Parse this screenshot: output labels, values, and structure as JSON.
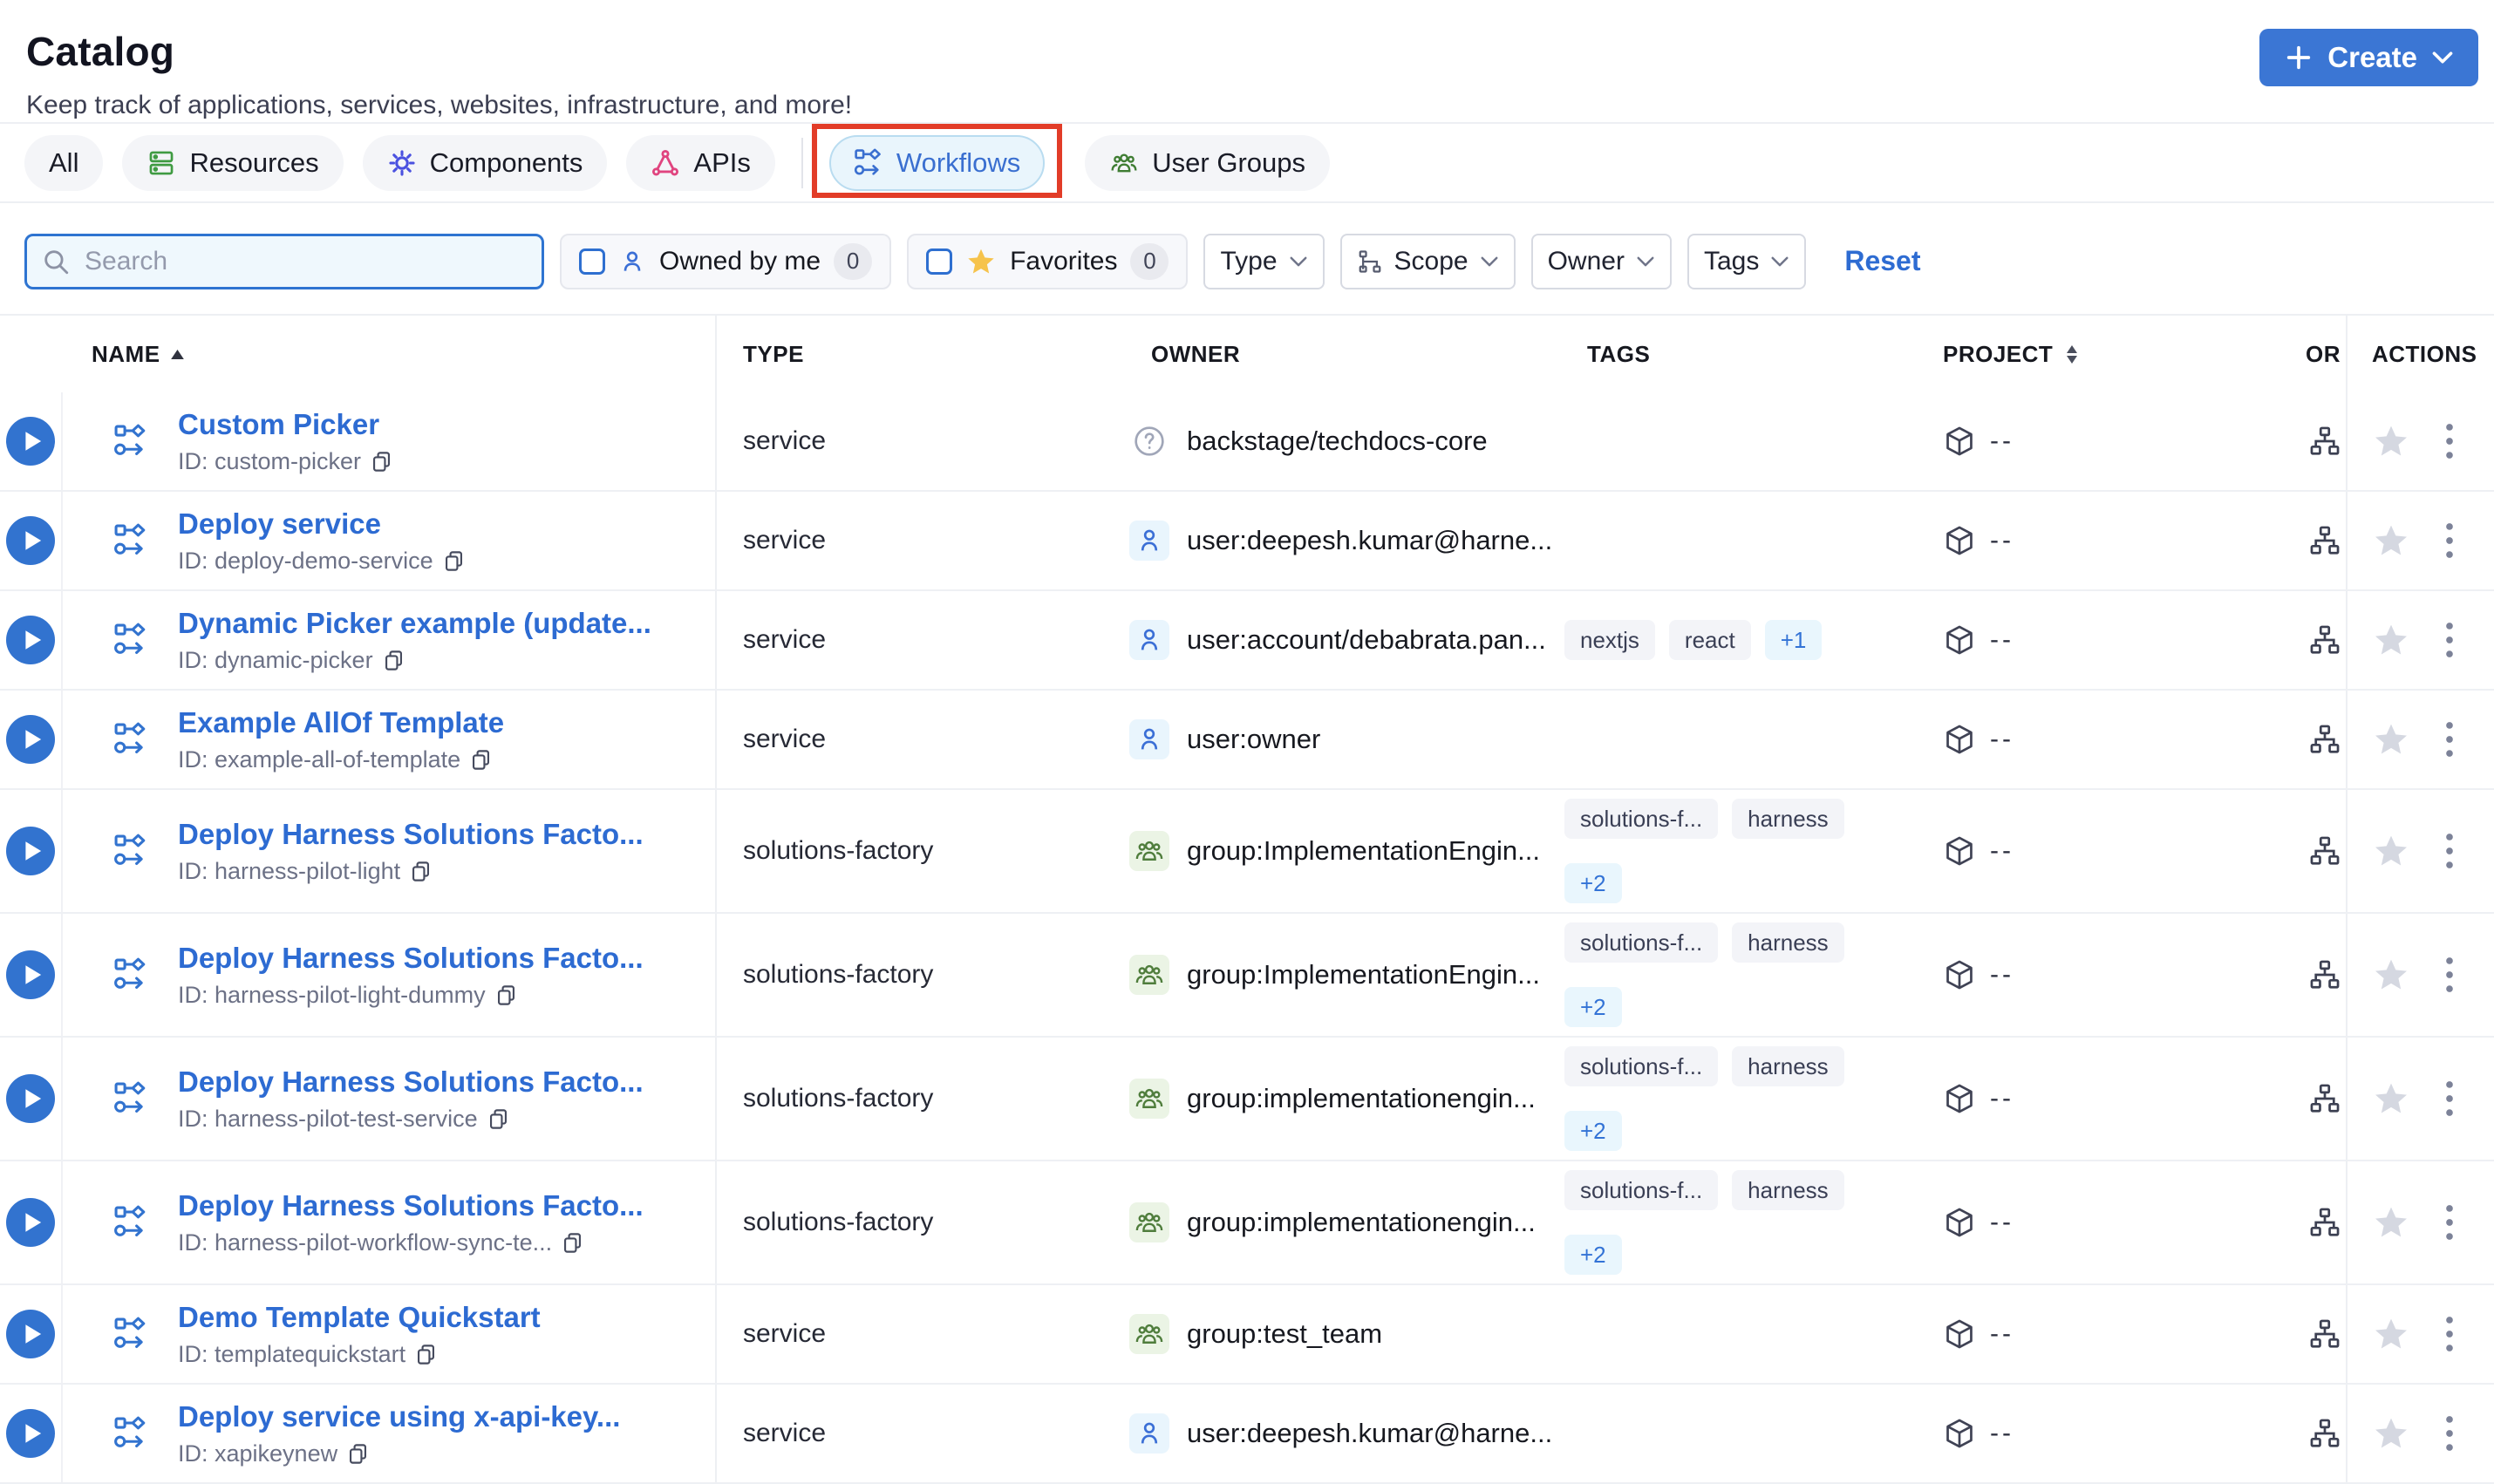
{
  "colors": {
    "accent_blue": "#3b76d4",
    "link_blue": "#2d6bd2",
    "active_tab_bg": "#e9f5fc",
    "annotation_red": "#e23c28",
    "favorite_star_yellow": "#f6c34c",
    "row_star_gray": "#d5d8e1",
    "tag_more_blue": "#3373d6"
  },
  "page": {
    "title": "Catalog",
    "subtitle": "Keep track of applications, services, websites, infrastructure, and more!"
  },
  "create_button": {
    "label": "Create"
  },
  "tabs": [
    {
      "label": "All"
    },
    {
      "label": "Resources"
    },
    {
      "label": "Components"
    },
    {
      "label": "APIs"
    },
    {
      "label": "Workflows"
    },
    {
      "label": "User Groups"
    }
  ],
  "filters": {
    "search": {
      "placeholder": "Search"
    },
    "owned_by_me": {
      "label": "Owned by me",
      "count": "0"
    },
    "favorites": {
      "label": "Favorites",
      "count": "0"
    },
    "type": {
      "label": "Type"
    },
    "scope": {
      "label": "Scope"
    },
    "owner": {
      "label": "Owner"
    },
    "tags": {
      "label": "Tags"
    },
    "reset_label": "Reset"
  },
  "table": {
    "columns": {
      "name": "NAME",
      "type": "TYPE",
      "owner": "OWNER",
      "tags": "TAGS",
      "project": "PROJECT",
      "org_truncated": "OR",
      "actions": "ACTIONS"
    },
    "id_prefix": "ID:",
    "project_placeholder": "--",
    "rows": [
      {
        "name": "Custom Picker",
        "id": "custom-picker",
        "type": "service",
        "owner": {
          "kind": "unknown",
          "label": "backstage/techdocs-core"
        },
        "tags": [],
        "tags_more": null,
        "more_on_new_line": false
      },
      {
        "name": "Deploy service",
        "id": "deploy-demo-service",
        "type": "service",
        "owner": {
          "kind": "user",
          "label": "user:deepesh.kumar@harne..."
        },
        "tags": [],
        "tags_more": null,
        "more_on_new_line": false
      },
      {
        "name": "Dynamic Picker example (update...",
        "id": "dynamic-picker",
        "type": "service",
        "owner": {
          "kind": "user",
          "label": "user:account/debabrata.pan..."
        },
        "tags": [
          "nextjs",
          "react"
        ],
        "tags_more": "+1",
        "more_on_new_line": false
      },
      {
        "name": "Example AllOf Template",
        "id": "example-all-of-template",
        "type": "service",
        "owner": {
          "kind": "user",
          "label": "user:owner"
        },
        "tags": [],
        "tags_more": null,
        "more_on_new_line": false
      },
      {
        "name": "Deploy Harness Solutions Facto...",
        "id": "harness-pilot-light",
        "type": "solutions-factory",
        "owner": {
          "kind": "group",
          "label": "group:ImplementationEngin..."
        },
        "tags": [
          "solutions-f...",
          "harness"
        ],
        "tags_more": "+2",
        "more_on_new_line": true
      },
      {
        "name": "Deploy Harness Solutions Facto...",
        "id": "harness-pilot-light-dummy",
        "type": "solutions-factory",
        "owner": {
          "kind": "group",
          "label": "group:ImplementationEngin..."
        },
        "tags": [
          "solutions-f...",
          "harness"
        ],
        "tags_more": "+2",
        "more_on_new_line": true
      },
      {
        "name": "Deploy Harness Solutions Facto...",
        "id": "harness-pilot-test-service",
        "type": "solutions-factory",
        "owner": {
          "kind": "group",
          "label": "group:implementationengin..."
        },
        "tags": [
          "solutions-f...",
          "harness"
        ],
        "tags_more": "+2",
        "more_on_new_line": true
      },
      {
        "name": "Deploy Harness Solutions Facto...",
        "id": "harness-pilot-workflow-sync-te...",
        "type": "solutions-factory",
        "owner": {
          "kind": "group",
          "label": "group:implementationengin..."
        },
        "tags": [
          "solutions-f...",
          "harness"
        ],
        "tags_more": "+2",
        "more_on_new_line": true
      },
      {
        "name": "Demo Template Quickstart",
        "id": "templatequickstart",
        "type": "service",
        "owner": {
          "kind": "group",
          "label": "group:test_team"
        },
        "tags": [],
        "tags_more": null,
        "more_on_new_line": false
      },
      {
        "name": "Deploy service using x-api-key...",
        "id": "xapikeynew",
        "type": "service",
        "owner": {
          "kind": "user",
          "label": "user:deepesh.kumar@harne..."
        },
        "tags": [],
        "tags_more": null,
        "more_on_new_line": false
      }
    ]
  }
}
